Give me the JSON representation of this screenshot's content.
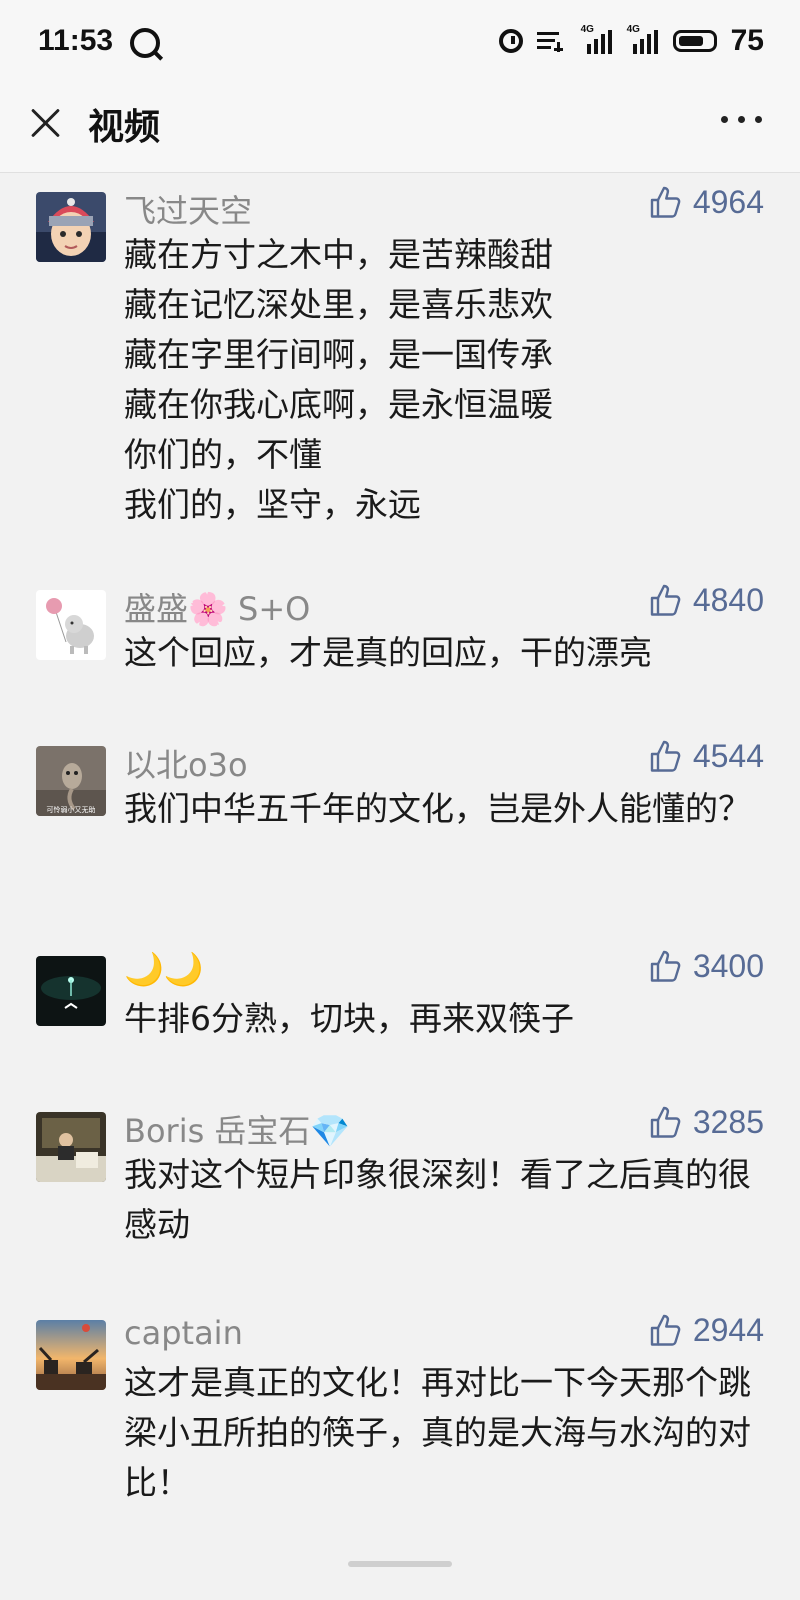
{
  "status_bar": {
    "time": "11:53",
    "battery": "75",
    "signal_label_1": "4G",
    "signal_label_2": "4G",
    "battery_level": 0.75
  },
  "header": {
    "title": "视频"
  },
  "comments": [
    {
      "username": "飞过天空",
      "likes": "4964",
      "text": "藏在方寸之木中，是苦辣酸甜\n藏在记忆深处里，是喜乐悲欢\n藏在字里行间啊，是一国传承\n藏在你我心底啊，是永恒温暖\n你们的，不懂\n我们的，坚守，永远"
    },
    {
      "username": "盛盛🌸 S+O",
      "likes": "4840",
      "text": "这个回应，才是真的回应，干的漂亮"
    },
    {
      "username": "以北o3o",
      "likes": "4544",
      "text": "我们中华五千年的文化，岂是外人能懂的？",
      "avatar_caption": "可怜弱小又无助"
    },
    {
      "username": "🌙🌙",
      "likes": "3400",
      "text": "牛排6分熟，切块，再来双筷子"
    },
    {
      "username": "Boris 岳宝石💎",
      "likes": "3285",
      "text": "我对这个短片印象很深刻！看了之后真的很感动"
    },
    {
      "username": "captain",
      "likes": "2944",
      "text": "这才是真正的文化！再对比一下今天那个跳梁小丑所拍的筷子，真的是大海与水沟的对比！"
    }
  ],
  "colors": {
    "like_blue": "#576b95",
    "username_gray": "#888888",
    "background": "#f2f2f2"
  }
}
